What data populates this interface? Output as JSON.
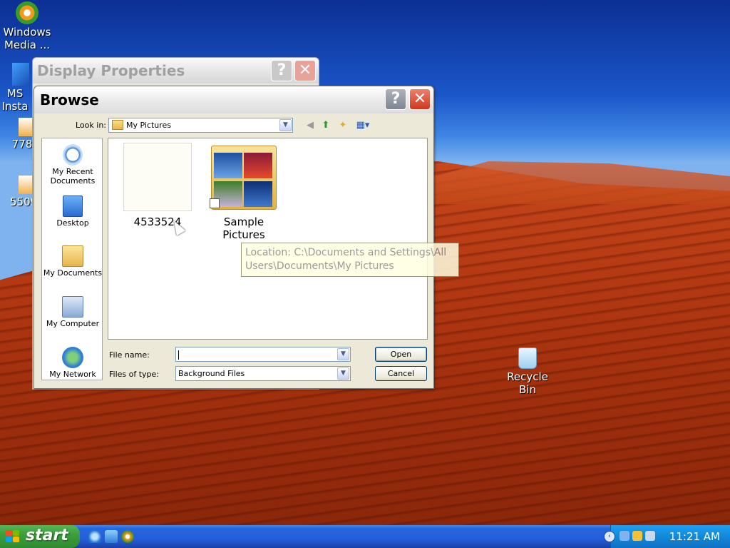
{
  "desktop": {
    "icons": [
      {
        "label": "Windows Media ..."
      },
      {
        "label": "MS Insta"
      },
      {
        "label": "778"
      },
      {
        "label": "5509"
      },
      {
        "label": "Recycle Bin"
      }
    ]
  },
  "display_properties": {
    "title": "Display Properties",
    "help_glyph": "?",
    "close_glyph": "✕"
  },
  "browse": {
    "title": "Browse",
    "help_glyph": "?",
    "close_glyph": "✕",
    "look_in_label": "Look in:",
    "look_in_value": "My Pictures",
    "places": [
      {
        "label": "My Recent Documents"
      },
      {
        "label": "Desktop"
      },
      {
        "label": "My Documents"
      },
      {
        "label": "My Computer"
      },
      {
        "label": "My Network"
      }
    ],
    "files": [
      {
        "name": "4533524"
      },
      {
        "name": "Sample Pictures"
      }
    ],
    "tooltip": "Location: C:\\Documents and Settings\\All Users\\Documents\\My Pictures",
    "file_name_label": "File name:",
    "file_name_value": "",
    "files_of_type_label": "Files of type:",
    "files_of_type_value": "Background Files",
    "open_label": "Open",
    "cancel_label": "Cancel"
  },
  "taskbar": {
    "start_label": "start",
    "clock": "11:21 AM"
  },
  "colors": {
    "taskbar_blue": "#245edb",
    "start_green": "#3c9f3c",
    "tray_blue": "#1289d8",
    "tooltip_bg": "#ffffe1"
  }
}
